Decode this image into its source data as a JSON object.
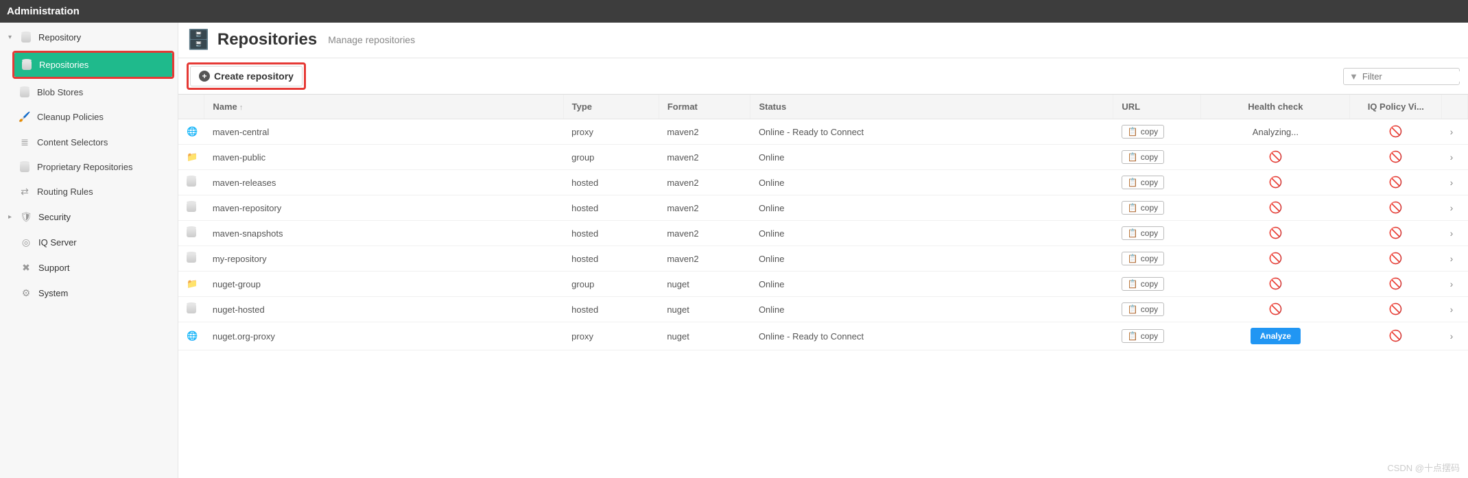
{
  "admin_bar": "Administration",
  "sidebar": {
    "items": [
      {
        "label": "Repository",
        "icon": "db",
        "level": 0,
        "caret": "▾"
      },
      {
        "label": "Repositories",
        "icon": "db",
        "level": 1,
        "selected": true,
        "highlight": true
      },
      {
        "label": "Blob Stores",
        "icon": "db",
        "level": 1
      },
      {
        "label": "Cleanup Policies",
        "icon": "brush",
        "level": 1
      },
      {
        "label": "Content Selectors",
        "icon": "layers",
        "level": 1
      },
      {
        "label": "Proprietary Repositories",
        "icon": "db",
        "level": 1
      },
      {
        "label": "Routing Rules",
        "icon": "rules",
        "level": 1
      },
      {
        "label": "Security",
        "icon": "shield",
        "level": 0,
        "caret": "▸"
      },
      {
        "label": "IQ Server",
        "icon": "iq",
        "level": 0
      },
      {
        "label": "Support",
        "icon": "support",
        "level": 0
      },
      {
        "label": "System",
        "icon": "gear",
        "level": 0
      }
    ]
  },
  "header": {
    "title": "Repositories",
    "subtitle": "Manage repositories"
  },
  "toolbar": {
    "create_label": "Create repository",
    "filter_placeholder": "Filter"
  },
  "columns": {
    "name": "Name",
    "type": "Type",
    "format": "Format",
    "status": "Status",
    "url": "URL",
    "health": "Health check",
    "iq": "IQ Policy Vi..."
  },
  "copy_label": "copy",
  "analyze_label": "Analyze",
  "analyzing_label": "Analyzing...",
  "rows": [
    {
      "icon": "proxy",
      "name": "maven-central",
      "type": "proxy",
      "format": "maven2",
      "status": "Online - Ready to Connect",
      "health": "analyzing"
    },
    {
      "icon": "group",
      "name": "maven-public",
      "type": "group",
      "format": "maven2",
      "status": "Online",
      "health": "none"
    },
    {
      "icon": "hosted",
      "name": "maven-releases",
      "type": "hosted",
      "format": "maven2",
      "status": "Online",
      "health": "none"
    },
    {
      "icon": "hosted",
      "name": "maven-repository",
      "type": "hosted",
      "format": "maven2",
      "status": "Online",
      "health": "none"
    },
    {
      "icon": "hosted",
      "name": "maven-snapshots",
      "type": "hosted",
      "format": "maven2",
      "status": "Online",
      "health": "none"
    },
    {
      "icon": "hosted",
      "name": "my-repository",
      "type": "hosted",
      "format": "maven2",
      "status": "Online",
      "health": "none"
    },
    {
      "icon": "group",
      "name": "nuget-group",
      "type": "group",
      "format": "nuget",
      "status": "Online",
      "health": "none"
    },
    {
      "icon": "hosted",
      "name": "nuget-hosted",
      "type": "hosted",
      "format": "nuget",
      "status": "Online",
      "health": "none"
    },
    {
      "icon": "proxy",
      "name": "nuget.org-proxy",
      "type": "proxy",
      "format": "nuget",
      "status": "Online - Ready to Connect",
      "health": "analyze"
    }
  ],
  "watermark": "CSDN @十点摆码"
}
